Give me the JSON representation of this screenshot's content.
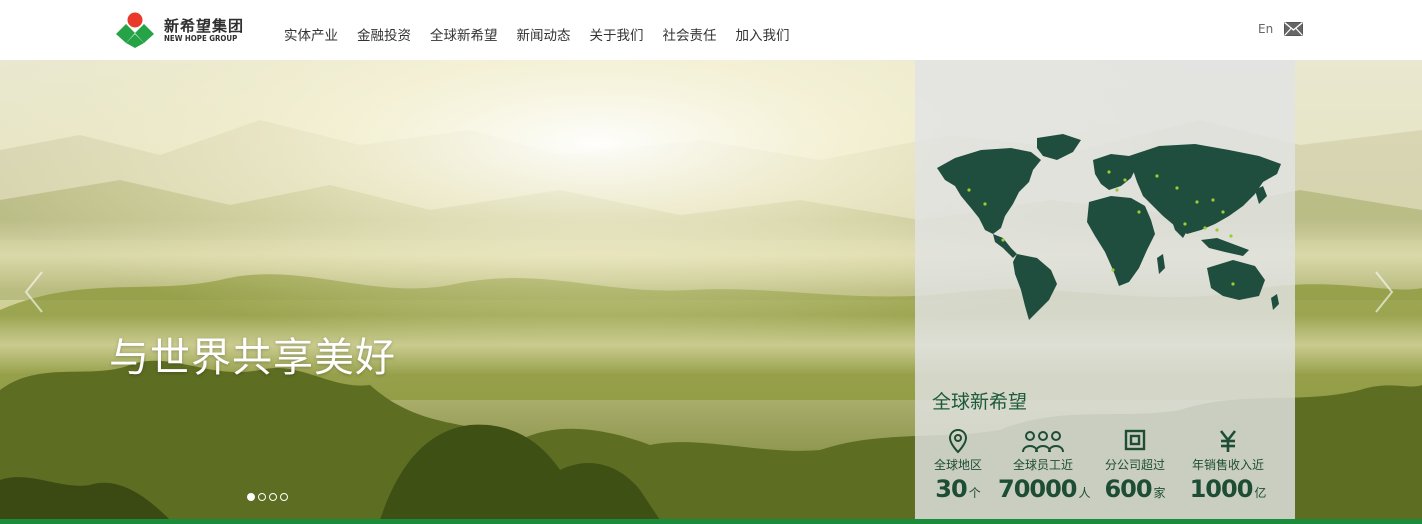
{
  "brand": {
    "name_cn": "新希望集团",
    "name_en": "NEW HOPE GROUP",
    "colors": {
      "red": "#e8392a",
      "green": "#27a347",
      "dark_green": "#1e4d35"
    }
  },
  "nav": {
    "items": [
      {
        "label": "实体产业"
      },
      {
        "label": "金融投资"
      },
      {
        "label": "全球新希望"
      },
      {
        "label": "新闻动态"
      },
      {
        "label": "关于我们"
      },
      {
        "label": "社会责任"
      },
      {
        "label": "加入我们"
      }
    ],
    "lang": "En",
    "mail_icon": "mail-icon"
  },
  "hero": {
    "slogan": "与世界共享美好",
    "slide_count": 4,
    "active_slide": 1,
    "icons": {
      "prev": "chevron-left-icon",
      "next": "chevron-right-icon"
    }
  },
  "global_panel": {
    "title": "全球新希望",
    "stats": [
      {
        "icon": "location-pin-icon",
        "label": "全球地区",
        "value": "30",
        "unit": "个"
      },
      {
        "icon": "people-icon",
        "label": "全球员工近",
        "value": "70000",
        "unit": "人"
      },
      {
        "icon": "office-icon",
        "label": "分公司超过",
        "value": "600",
        "unit": "家"
      },
      {
        "icon": "yuan-icon",
        "label": "年销售收入近",
        "value": "1000",
        "unit": "亿"
      }
    ]
  }
}
